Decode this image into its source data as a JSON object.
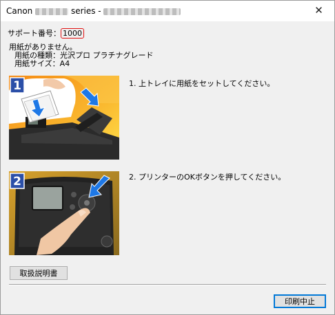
{
  "window": {
    "title_prefix": "Canon",
    "title_mid": "series -",
    "close_glyph": "✕"
  },
  "support": {
    "label": "サポート番号：",
    "code": "1000"
  },
  "message": {
    "line1": "用紙がありません。",
    "line2": "用紙の種類：光沢プロ プラチナグレード",
    "line3": "用紙サイズ：A4"
  },
  "steps": [
    {
      "number": "1",
      "text": "1.  上トレイに用紙をセットしてください。"
    },
    {
      "number": "2",
      "text": "2.  プリンターのOKボタンを押してください。"
    }
  ],
  "buttons": {
    "manual": "取扱説明書",
    "cancel": "印刷中止"
  },
  "colors": {
    "alert": "#e01010",
    "step1_bg": "#f7a51a",
    "step2_bg": "#c8961e",
    "arrow": "#1e78e6",
    "badge": "#2b4fa8"
  }
}
